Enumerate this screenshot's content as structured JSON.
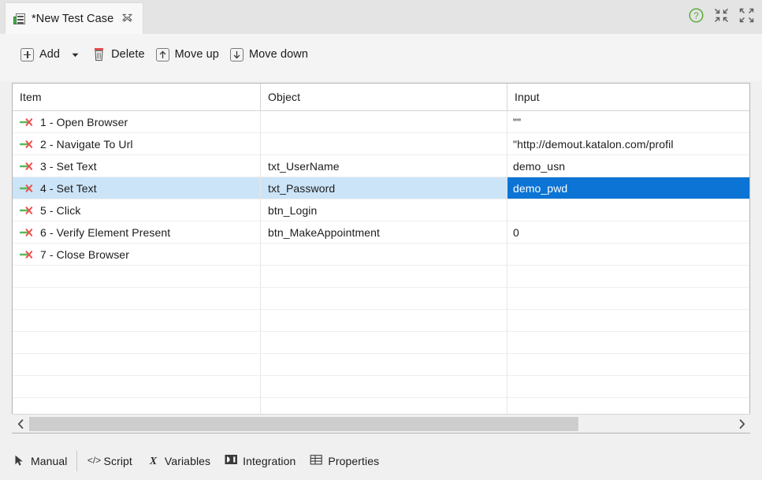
{
  "window": {
    "tab": {
      "title": "*New Test Case",
      "icon": "test-case-icon",
      "close_icon": "close-tab-icon"
    },
    "tools": [
      {
        "name": "help-icon",
        "label": "?",
        "color": "#5aab3c"
      },
      {
        "name": "minimize-icon",
        "label": "Minimize"
      },
      {
        "name": "maximize-icon",
        "label": "Maximize"
      }
    ]
  },
  "toolbar": {
    "add_label": "Add",
    "add_icon": "plus-icon",
    "add_dropdown_icon": "chevron-down-icon",
    "delete_label": "Delete",
    "delete_icon": "trash-icon",
    "move_up_label": "Move up",
    "move_up_icon": "arrow-up-icon",
    "move_down_label": "Move down",
    "move_down_icon": "arrow-down-icon"
  },
  "table": {
    "columns": [
      "Item",
      "Object",
      "Input"
    ],
    "rows": [
      {
        "step_icon": "green-arrow-red-x-icon",
        "item": "1 - Open Browser",
        "object": "",
        "input": "\"\"",
        "selected": false
      },
      {
        "step_icon": "green-arrow-red-x-icon",
        "item": "2 - Navigate To Url",
        "object": "",
        "input": "\"http://demout.katalon.com/profil",
        "selected": false
      },
      {
        "step_icon": "green-arrow-red-x-icon",
        "item": "3 - Set Text",
        "object": "txt_UserName",
        "input": "demo_usn",
        "selected": false
      },
      {
        "step_icon": "green-arrow-red-x-icon",
        "item": "4 - Set Text",
        "object": "txt_Password",
        "input": "demo_pwd",
        "selected": true
      },
      {
        "step_icon": "green-arrow-red-x-icon",
        "item": "5 - Click",
        "object": "btn_Login",
        "input": "",
        "selected": false
      },
      {
        "step_icon": "green-arrow-red-x-icon",
        "item": "6 - Verify Element Present",
        "object": "btn_MakeAppointment",
        "input": "0",
        "selected": false
      },
      {
        "step_icon": "green-arrow-red-x-icon",
        "item": "7 - Close Browser",
        "object": "",
        "input": "",
        "selected": false
      },
      {
        "step_icon": "",
        "item": "",
        "object": "",
        "input": "",
        "selected": false
      },
      {
        "step_icon": "",
        "item": "",
        "object": "",
        "input": "",
        "selected": false
      },
      {
        "step_icon": "",
        "item": "",
        "object": "",
        "input": "",
        "selected": false
      },
      {
        "step_icon": "",
        "item": "",
        "object": "",
        "input": "",
        "selected": false
      },
      {
        "step_icon": "",
        "item": "",
        "object": "",
        "input": "",
        "selected": false
      },
      {
        "step_icon": "",
        "item": "",
        "object": "",
        "input": "",
        "selected": false
      },
      {
        "step_icon": "",
        "item": "",
        "object": "",
        "input": "",
        "selected": false
      }
    ],
    "selection_color": "#0b74d4",
    "selected_row_color": "#cce4f7"
  },
  "scrollbar": {
    "left_arrow_icon": "chevron-left-icon",
    "right_arrow_icon": "chevron-right-icon",
    "thumb_percent": "78"
  },
  "bottom_tabs": [
    {
      "label": "Manual",
      "icon": "cursor-icon",
      "active": true
    },
    {
      "label": "Script",
      "icon": "code-icon",
      "active": false
    },
    {
      "label": "Variables",
      "icon": "variables-icon",
      "active": false
    },
    {
      "label": "Integration",
      "icon": "integration-icon",
      "active": false
    },
    {
      "label": "Properties",
      "icon": "table-grid-icon",
      "active": false
    }
  ]
}
